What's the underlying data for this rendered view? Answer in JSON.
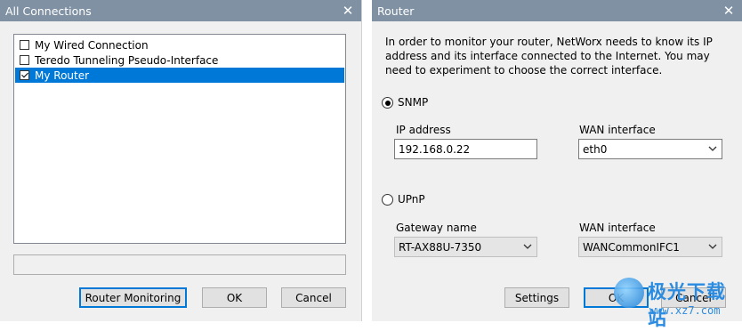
{
  "left_window": {
    "title": "All Connections",
    "items": [
      {
        "label": "My Wired Connection",
        "checked": false,
        "selected": false
      },
      {
        "label": "Teredo Tunneling Pseudo-Interface",
        "checked": false,
        "selected": false
      },
      {
        "label": "My Router",
        "checked": true,
        "selected": true
      }
    ],
    "status_text": "",
    "buttons": {
      "router_monitoring": "Router Monitoring",
      "ok": "OK",
      "cancel": "Cancel"
    }
  },
  "right_window": {
    "title": "Router",
    "intro": "In order to monitor your router, NetWorx needs to know its IP address and its interface connected to the Internet. You may need to experiment to choose the correct interface.",
    "snmp": {
      "label": "SNMP",
      "selected": true,
      "ip_label": "IP address",
      "ip_value": "192.168.0.22",
      "wan_label": "WAN interface",
      "wan_value": "eth0"
    },
    "upnp": {
      "label": "UPnP",
      "selected": false,
      "gateway_label": "Gateway name",
      "gateway_value": "RT-AX88U-7350",
      "wan_label": "WAN interface",
      "wan_value": "WANCommonIFC1"
    },
    "buttons": {
      "settings": "Settings",
      "ok": "OK",
      "cancel": "Cancel"
    }
  },
  "watermark": {
    "text": "极光下载站",
    "url": "www.xz7.com"
  },
  "colors": {
    "titlebar": "#7f91a3",
    "selection": "#0078d7",
    "dialog_bg": "#f0f0f0"
  }
}
